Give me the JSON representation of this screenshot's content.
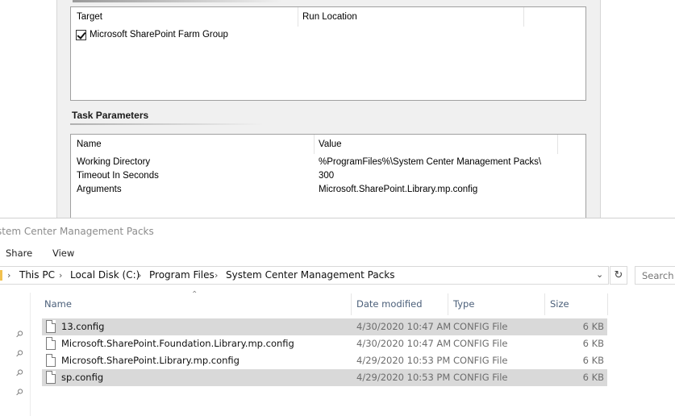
{
  "task_dialog": {
    "targets": {
      "columns": [
        "Target",
        "Run Location"
      ],
      "rows": [
        {
          "name": "Microsoft SharePoint Farm Group",
          "run_location": "",
          "checked": true
        }
      ]
    },
    "params_section_title": "Task Parameters",
    "params": {
      "columns": [
        "Name",
        "Value"
      ],
      "rows": [
        {
          "name": "Working Directory",
          "value": "%ProgramFiles%\\System Center Management Packs\\"
        },
        {
          "name": "Timeout In Seconds",
          "value": "300"
        },
        {
          "name": "Arguments",
          "value": "Microsoft.SharePoint.Library.mp.config"
        }
      ]
    }
  },
  "explorer": {
    "title": "stem Center Management Packs",
    "ribbon_tabs": [
      "Share",
      "View"
    ],
    "breadcrumb": [
      "This PC",
      "Local Disk (C:)",
      "Program Files",
      "System Center Management Packs"
    ],
    "search_placeholder": "Search S",
    "columns": {
      "name": "Name",
      "date": "Date modified",
      "type": "Type",
      "size": "Size"
    },
    "files": [
      {
        "name": "13.config",
        "date": "4/30/2020 10:47 AM",
        "type": "CONFIG File",
        "size": "6 KB",
        "selected": true
      },
      {
        "name": "Microsoft.SharePoint.Foundation.Library.mp.config",
        "date": "4/30/2020 10:47 AM",
        "type": "CONFIG File",
        "size": "6 KB",
        "selected": false
      },
      {
        "name": "Microsoft.SharePoint.Library.mp.config",
        "date": "4/29/2020 10:53 PM",
        "type": "CONFIG File",
        "size": "6 KB",
        "selected": false
      },
      {
        "name": "sp.config",
        "date": "4/29/2020 10:53 PM",
        "type": "CONFIG File",
        "size": "6 KB",
        "selected": true
      }
    ]
  }
}
